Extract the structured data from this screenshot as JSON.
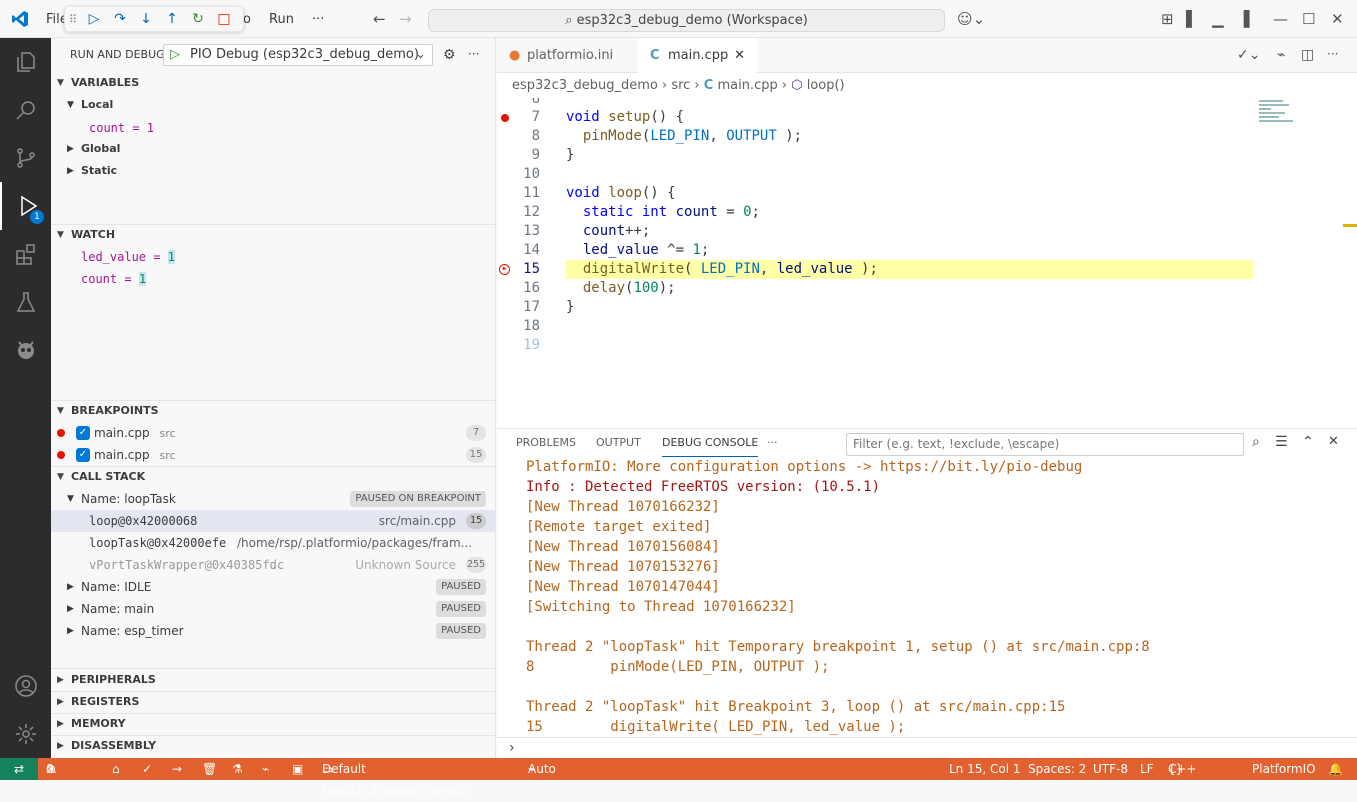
{
  "titlebar": {
    "menu_file": "File",
    "menu_go": "o",
    "menu_run": "Run",
    "menu_more": "···",
    "search": "esp32c3_debug_demo (Workspace)"
  },
  "sidebar": {
    "title": "RUN AND DEBUG",
    "config": "PIO Debug (esp32c3_debug_demo)",
    "variables": {
      "header": "VARIABLES",
      "local": "Local",
      "count_label": "count = 1",
      "global": "Global",
      "static": "Static"
    },
    "watch": {
      "header": "WATCH",
      "items": [
        {
          "name": "led_value",
          "value": "1"
        },
        {
          "name": "count",
          "value": "1"
        }
      ]
    },
    "breakpoints": {
      "header": "BREAKPOINTS",
      "items": [
        {
          "file": "main.cpp",
          "dir": "src",
          "line": "7"
        },
        {
          "file": "main.cpp",
          "dir": "src",
          "line": "15"
        }
      ]
    },
    "callstack": {
      "header": "CALL STACK",
      "thread": "Name: loopTask",
      "thread_state": "PAUSED ON BREAKPOINT",
      "frames": [
        {
          "name": "loop@0x42000068",
          "src": "src/main.cpp",
          "line": "15"
        },
        {
          "name": "loopTask@0x42000efe",
          "src": "/home/rsp/.platformio/packages/fram..."
        },
        {
          "name": "vPortTaskWrapper@0x40385fdc",
          "src": "Unknown Source",
          "line": "255"
        }
      ],
      "threads": [
        {
          "name": "Name: IDLE",
          "state": "PAUSED"
        },
        {
          "name": "Name: main",
          "state": "PAUSED"
        },
        {
          "name": "Name: esp_timer",
          "state": "PAUSED"
        }
      ]
    },
    "peripherals": "PERIPHERALS",
    "registers": "REGISTERS",
    "memory": "MEMORY",
    "disassembly": "DISASSEMBLY"
  },
  "activity_badge": "1",
  "editor": {
    "tabs": [
      {
        "label": "platformio.ini"
      },
      {
        "label": "main.cpp"
      }
    ],
    "crumbs": {
      "root": "esp32c3_debug_demo",
      "src": "src",
      "file": "main.cpp",
      "sym": "loop()"
    },
    "line_numbers": [
      "6",
      "7",
      "8",
      "9",
      "10",
      "11",
      "12",
      "13",
      "14",
      "15",
      "16",
      "17",
      "18",
      "19"
    ]
  },
  "panel": {
    "tabs": [
      "PROBLEMS",
      "OUTPUT",
      "DEBUG CONSOLE"
    ],
    "filter_placeholder": "Filter (e.g. text, !exclude, \\escape)",
    "lines": [
      "PlatformIO: More configuration options -> https://bit.ly/pio-debug",
      "Info : Detected FreeRTOS version: (10.5.1)",
      "[New Thread 1070166232]",
      "[Remote target exited]",
      "[New Thread 1070156084]",
      "[New Thread 1070153276]",
      "[New Thread 1070147044]",
      "[Switching to Thread 1070166232]",
      "",
      "Thread 2 \"loopTask\" hit Temporary breakpoint 1, setup () at src/main.cpp:8",
      "8         pinMode(LED_PIN, OUTPUT );",
      "",
      "Thread 2 \"loopTask\" hit Breakpoint 3, loop () at src/main.cpp:15",
      "15        digitalWrite( LED_PIN, led_value );"
    ]
  },
  "status": {
    "errors": "0",
    "warnings": "0",
    "config": "Default (esp32c3_debug_demo)",
    "auto": "Auto",
    "pos": "Ln 15, Col 1",
    "spaces": "Spaces: 2",
    "enc": "UTF-8",
    "eol": "LF",
    "lang": "C++",
    "pio": "PlatformIO"
  }
}
